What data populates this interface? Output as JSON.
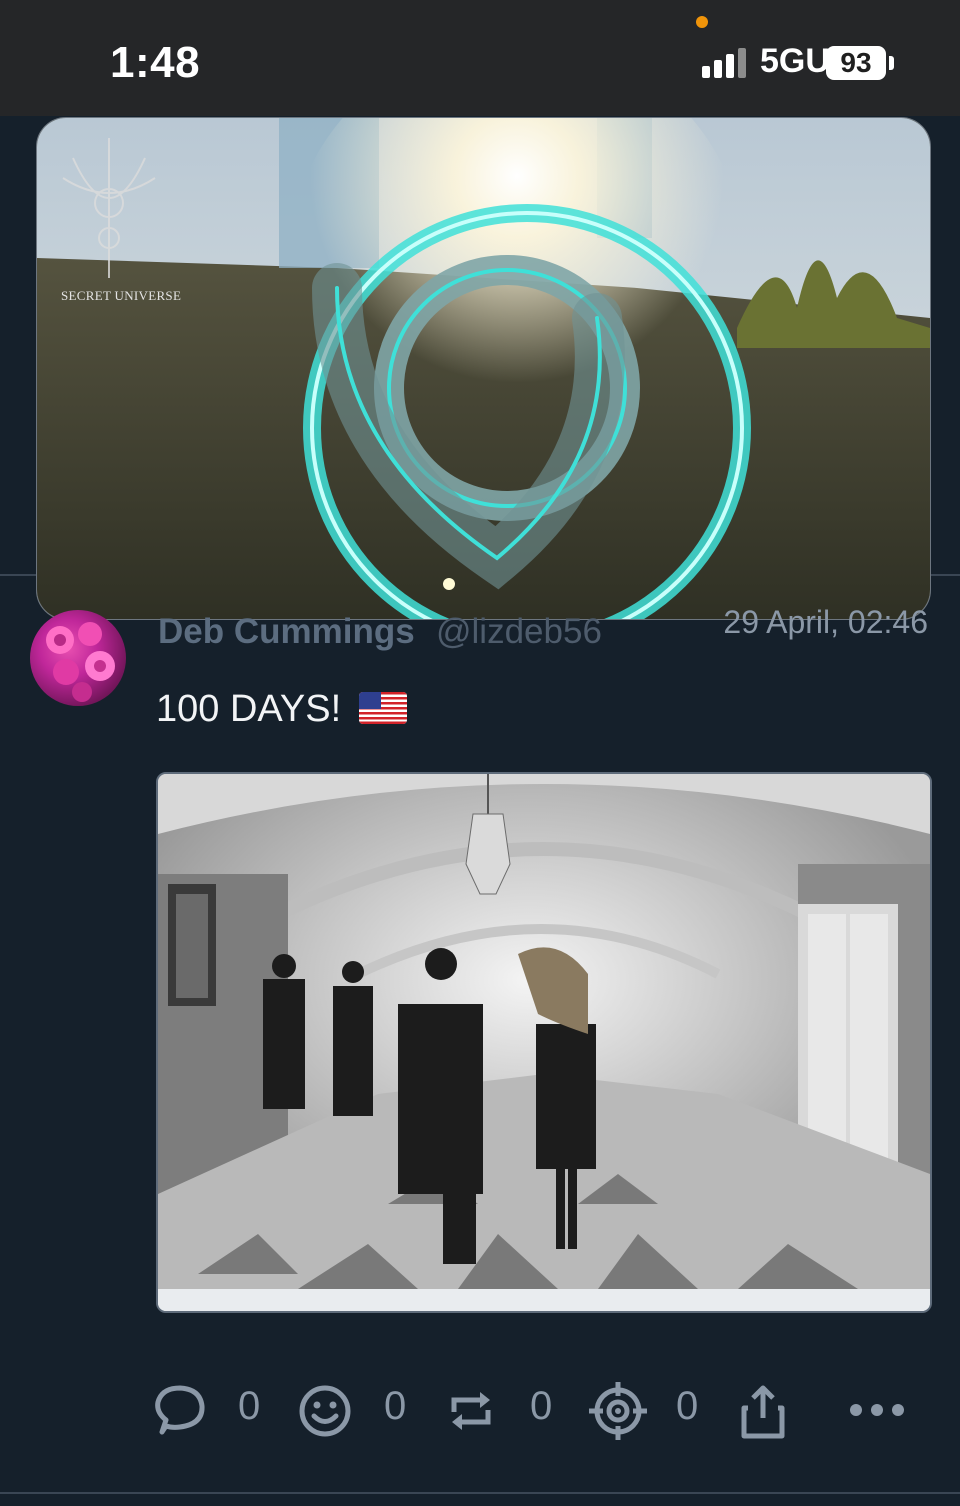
{
  "status_bar": {
    "time": "1:48",
    "network": "5GUW",
    "battery": "93",
    "privacy_dot_color": "#f0940a"
  },
  "video_overlay": {
    "watermark_text": "SECRET UNIVERSE",
    "glow_color": "#3fe0d8"
  },
  "post": {
    "author_name": "Deb Cummings",
    "author_handle": "@lizdeb56",
    "timestamp": "29 April, 02:46",
    "text": "100 DAYS!",
    "emoji": "flag-usa",
    "image_description_icon": "photo"
  },
  "actions": {
    "reply_count": "0",
    "reaction_count": "0",
    "repost_count": "0",
    "target_count": "0",
    "icons": [
      "speech-bubble-icon",
      "smiley-icon",
      "repost-icon",
      "target-icon",
      "share-icon",
      "more-icon"
    ]
  },
  "colors": {
    "background": "#15202b",
    "status_bar": "#252628",
    "muted_text": "#8b98a7",
    "divider": "#3a4654"
  }
}
